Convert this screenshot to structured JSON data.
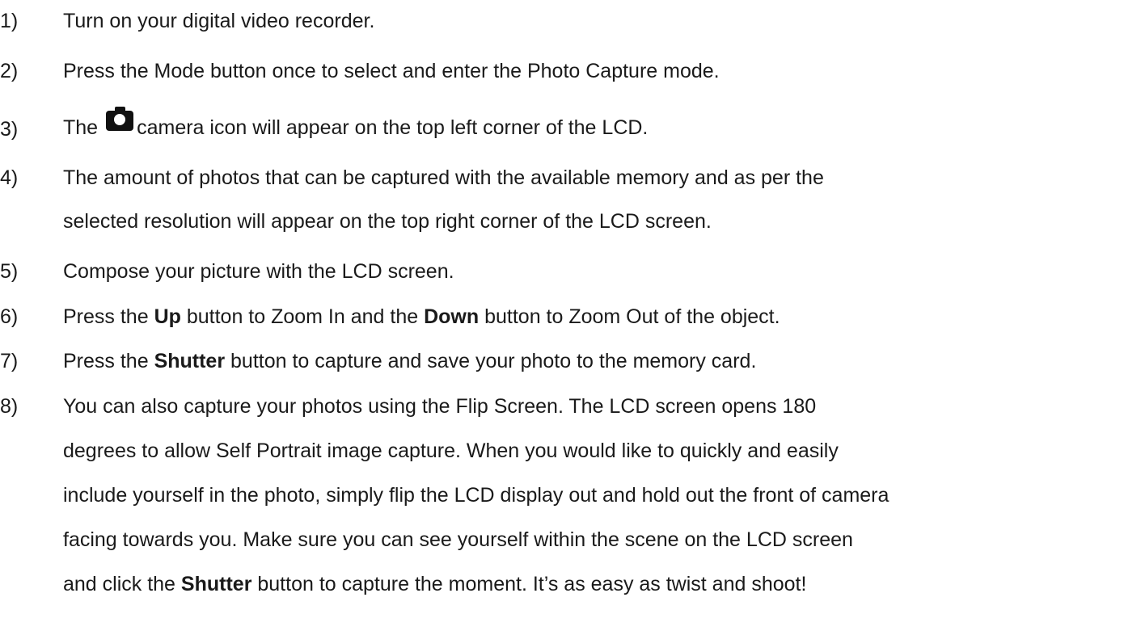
{
  "steps": [
    {
      "num": "1)",
      "lines": [
        [
          "Turn on your digital video recorder."
        ]
      ]
    },
    {
      "num": "2)",
      "lines": [
        [
          "Press the Mode button once to select and enter the Photo Capture mode."
        ]
      ]
    },
    {
      "num": "3)",
      "before_icon": "The",
      "icon": "camera-icon",
      "after_icon": "camera icon will appear on the top left corner of the LCD."
    },
    {
      "num": "4)",
      "lines": [
        [
          "The amount of photos that can be captured with the available memory and as per the"
        ],
        [
          "selected resolution will appear on the top right corner of the LCD screen."
        ]
      ]
    },
    {
      "num": "5)",
      "lines": [
        [
          "Compose your picture with the LCD screen."
        ]
      ]
    },
    {
      "num": "6)",
      "parts": [
        "Press the ",
        "Up",
        " button to Zoom In and the ",
        "Down",
        " button to Zoom Out of the object."
      ]
    },
    {
      "num": "7)",
      "parts": [
        "Press the ",
        "Shutter",
        " button to capture and save your photo to the memory card."
      ]
    },
    {
      "num": "8)",
      "lines": [
        [
          "You can also capture your photos using the Flip Screen. The LCD screen opens 180"
        ],
        [
          "degrees to allow Self Portrait image capture. When you would like to quickly and easily"
        ],
        [
          "include yourself in the photo, simply flip the LCD display out and hold out the front of camera"
        ],
        [
          "facing towards you. Make sure you can see yourself within the scene on the LCD screen"
        ]
      ],
      "last_parts": [
        "and click the ",
        "Shutter",
        " button to capture the moment. It’s as easy as twist and shoot!"
      ]
    }
  ]
}
